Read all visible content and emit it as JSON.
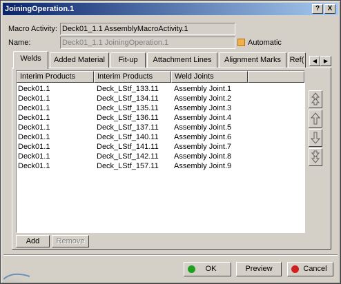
{
  "window": {
    "title": "JoiningOperation.1",
    "help_glyph": "?",
    "close_glyph": "X"
  },
  "macro_activity": {
    "label": "Macro Activity:",
    "value": "Deck01_1.1 AssemblyMacroActivity.1"
  },
  "name_field": {
    "label": "Name:",
    "value": "Deck01_1.1 JoiningOperation.1"
  },
  "automatic": {
    "label": "Automatic",
    "checked": true
  },
  "tabs": [
    {
      "label": "Welds",
      "active": true
    },
    {
      "label": "Added Material",
      "active": false
    },
    {
      "label": "Fit-up",
      "active": false
    },
    {
      "label": "Attachment Lines",
      "active": false
    },
    {
      "label": "Alignment Marks",
      "active": false
    },
    {
      "label": "Ref(",
      "active": false
    }
  ],
  "table": {
    "columns": [
      "Interim Products",
      "Interim Products",
      "Weld Joints"
    ],
    "rows": [
      [
        "Deck01.1",
        "Deck_LStf_133.11",
        "Assembly Joint.1"
      ],
      [
        "Deck01.1",
        "Deck_LStf_134.11",
        "Assembly Joint.2"
      ],
      [
        "Deck01.1",
        "Deck_LStf_135.11",
        "Assembly Joint.3"
      ],
      [
        "Deck01.1",
        "Deck_LStf_136.11",
        "Assembly Joint.4"
      ],
      [
        "Deck01.1",
        "Deck_LStf_137.11",
        "Assembly Joint.5"
      ],
      [
        "Deck01.1",
        "Deck_LStf_140.11",
        "Assembly Joint.6"
      ],
      [
        "Deck01.1",
        "Deck_LStf_141.11",
        "Assembly Joint.7"
      ],
      [
        "Deck01.1",
        "Deck_LStf_142.11",
        "Assembly Joint.8"
      ],
      [
        "Deck01.1",
        "Deck_LStf_157.11",
        "Assembly Joint.9"
      ]
    ]
  },
  "list_buttons": {
    "add": "Add",
    "remove": "Remove"
  },
  "footer": {
    "ok": "OK",
    "preview": "Preview",
    "cancel": "Cancel"
  },
  "colors": {
    "ok_dot": "#1fa01f",
    "cancel_dot": "#d02020",
    "checkbox": "#f0b048"
  },
  "icons": [
    "move-to-top-icon",
    "move-up-icon",
    "move-down-icon",
    "move-to-bottom-icon",
    "scroll-left-icon",
    "scroll-right-icon"
  ]
}
